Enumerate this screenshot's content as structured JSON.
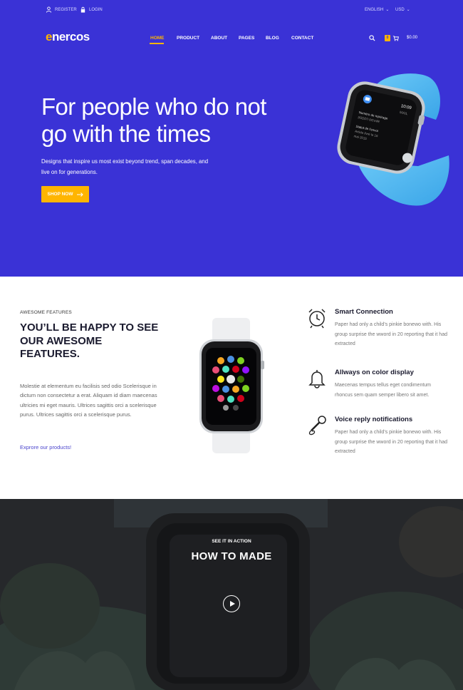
{
  "topbar": {
    "register": "REGISTER",
    "login": "LOGIN",
    "language": "ENGLISH",
    "currency": "USD"
  },
  "brand": {
    "logo_first": "e",
    "logo_rest": "nercos"
  },
  "nav": {
    "home": "HOME",
    "product": "PRODUCT",
    "about": "ABOUT",
    "pages": "PAGES",
    "blog": "BLOG",
    "contact": "CONTACT"
  },
  "cart": {
    "count": "0",
    "total": "$0.00"
  },
  "hero": {
    "title": "For people who do not go with the times",
    "subtitle": "Designs that inspire us most exist beyond trend, span decades, and live on for generations.",
    "button": "SHOP NOW",
    "watch_time": "10:09",
    "watch_app": "MAIL"
  },
  "features": {
    "kicker": "AWESOME FEATURES",
    "title": "YOU’LL BE HAPPY TO SEE OUR AWESOME FEATURES.",
    "paragraph": "Molestie at elementum eu facilisis sed odio Scelerisque in dictum non consectetur a erat. Aliquam id diam maecenas ultricies mi eget mauris. Ultrices sagittis orci a scelerisque purus. Ultrices sagittis orci a scelerisque purus.",
    "link": "Exprore our products!",
    "items": [
      {
        "title": "Smart Connection",
        "desc": "Paper had only a child’s pinkie bonewo with. His group surprise the wword in 20 reporting that it had extracted"
      },
      {
        "title": "Allways on color display",
        "desc": "Maecenas tempus tellus eget condimentum rhoncus sem quam semper libero sit amet."
      },
      {
        "title": "Voice reply notifications",
        "desc": "Paper had only a child’s pinkie bonewo with. His group surprise the wword in 20 reporting that it had extracted"
      }
    ]
  },
  "video": {
    "kicker": "SEE IT IN ACTION",
    "title": "HOW TO MADE"
  },
  "colors": {
    "primary": "#3a32d6",
    "accent": "#ffb500",
    "watch_band": "#4fb8f2"
  }
}
